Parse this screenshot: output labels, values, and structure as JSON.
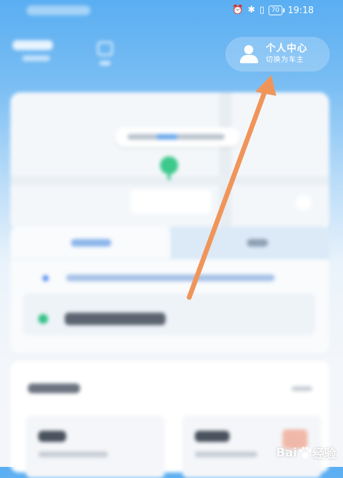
{
  "status_bar": {
    "alarm_icon": "alarm-clock-icon",
    "bluetooth_icon": "bluetooth-icon",
    "vibrate_icon": "vibrate-icon",
    "battery": "70",
    "time": "19:18"
  },
  "personal_center": {
    "title": "个人中心",
    "subtitle": "切换为车主",
    "icon": "person-icon"
  },
  "annotation": {
    "arrow_color": "#f0955a"
  },
  "watermark": {
    "text_bai": "Bai",
    "text_du": "经验"
  },
  "colors": {
    "header_blue": "#5aaef2",
    "accent_green": "#3cc98c"
  }
}
